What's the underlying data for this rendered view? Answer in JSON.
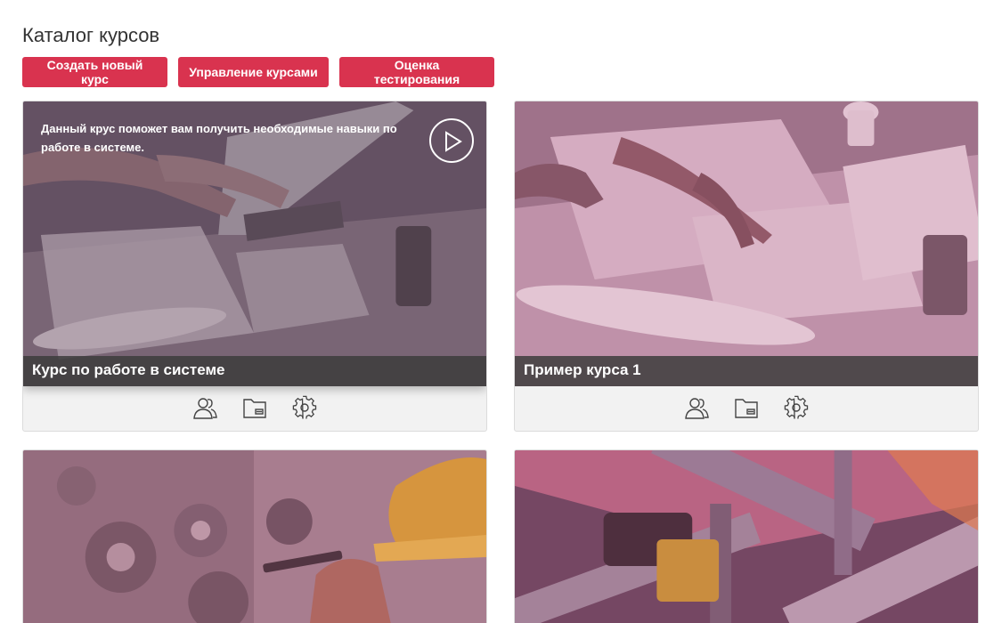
{
  "page": {
    "title": "Каталог курсов"
  },
  "toolbar": {
    "create_label": "Создать новый курс",
    "manage_label": "Управление курсами",
    "grading_label": "Оценка тестирования"
  },
  "colors": {
    "accent": "#d9334f",
    "card_bg": "#f2f2f2",
    "title_bar": "#3c3c3c"
  },
  "courses": [
    {
      "title": "Курс по работе в системе",
      "description": "Данный крус поможет вам получить необходимые навыки по работе в системе.",
      "image": "team-working-at-laptop-with-blueprints",
      "icons": [
        "users-icon",
        "folder-icon",
        "gear-icon"
      ]
    },
    {
      "title": "Пример курса 1",
      "image": "hands-pointing-at-blueprints",
      "icons": [
        "users-icon",
        "folder-icon",
        "gear-icon"
      ]
    },
    {
      "image": "worker-repairing-gears"
    },
    {
      "image": "industrial-pipes"
    }
  ]
}
